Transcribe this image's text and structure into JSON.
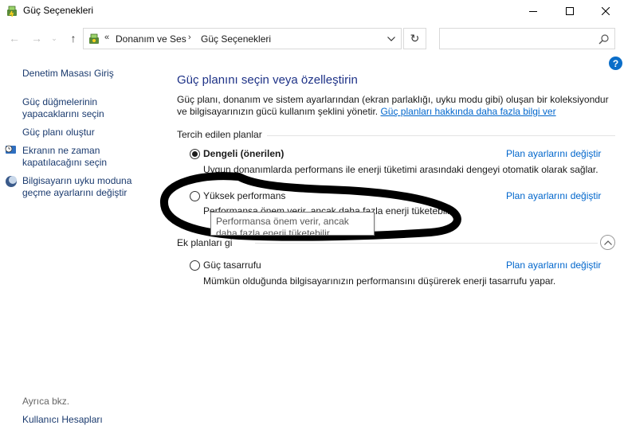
{
  "window": {
    "title": "Güç Seçenekleri",
    "icon": "power-options-icon"
  },
  "nav": {
    "back_icon": "←",
    "forward_icon": "→",
    "recent_icon": "⌄",
    "up_icon": "↑",
    "crumb_separator": "«",
    "breadcrumbs": [
      "Donanım ve Ses",
      "Güç Seçenekleri"
    ],
    "crumb_arrow": "›",
    "search_placeholder": "",
    "refresh_icon": "↻"
  },
  "help_label": "?",
  "left": {
    "home_link": "Denetim Masası Giriş",
    "links": [
      "Güç düğmelerinin yapacaklarını seçin",
      "Güç planı oluştur",
      "Ekranın ne zaman kapatılacağını seçin",
      "Bilgisayarın uyku moduna geçme ayarlarını değiştir"
    ],
    "see_also": "Ayrıca bkz.",
    "user_accounts": "Kullanıcı Hesapları"
  },
  "main": {
    "title": "Güç planını seçin veya özelleştirin",
    "intro_text": "Güç planı, donanım ve sistem ayarlarından (ekran parlaklığı, uyku modu gibi) oluşan bir koleksiyondur ve bilgisayarınızın gücü kullanım şeklini yönetir.",
    "intro_link": "Güç planları hakkında daha fazla bilgi ver",
    "preferred_label": "Tercih edilen planlar",
    "extra_label": "Ek planları gi",
    "plans": [
      {
        "name": "Dengeli (önerilen)",
        "desc": "Uygun donanımlarda performans ile enerji tüketimi arasındaki dengeyi otomatik olarak sağlar.",
        "link": "Plan ayarlarını değiştir",
        "selected": true
      },
      {
        "name": "Yüksek performans",
        "desc": "Performansa önem verir, ancak daha fazla enerji tüketebilir.",
        "link": "Plan ayarlarını değiştir",
        "selected": false
      },
      {
        "name": "Güç tasarrufu",
        "desc": "Mümkün olduğunda bilgisayarınızın performansını düşürerek enerji tasarrufu yapar.",
        "link": "Plan ayarlarını değiştir",
        "selected": false
      }
    ],
    "tooltip": "Performansa önem verir, ancak daha fazla enerji tüketebilir."
  },
  "colors": {
    "title_blue": "#1e3287",
    "link_blue": "#0066cc",
    "nav_link": "#1a3a6e",
    "annotation": "#000000"
  }
}
